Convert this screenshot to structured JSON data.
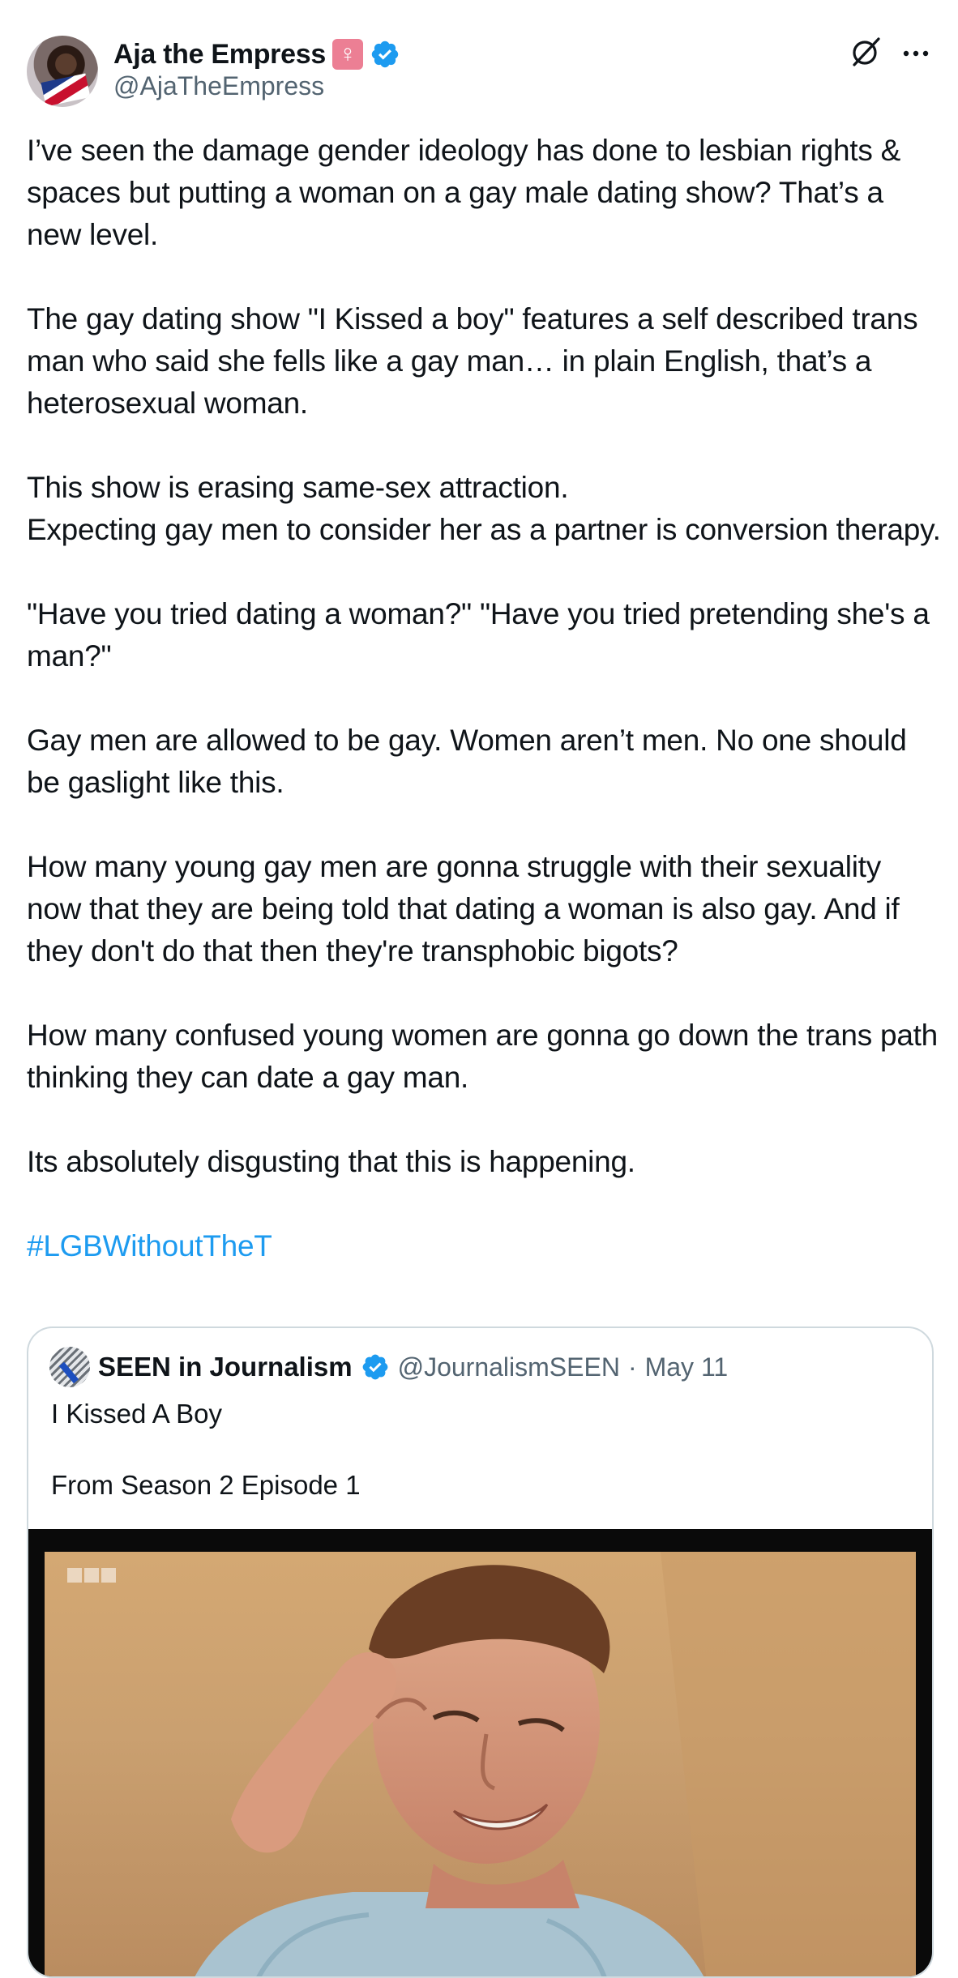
{
  "author": {
    "display_name": "Aja the Empress",
    "emoji": "♀",
    "handle": "@AjaTheEmpress",
    "verified": true
  },
  "icons": {
    "grok": "grok-icon",
    "more": "more-icon",
    "verified": "verified-badge-icon"
  },
  "tweet": {
    "paragraphs": [
      "I’ve seen the damage gender ideology has done to lesbian rights & spaces but putting a woman on a gay male dating show? That’s a new level.",
      "The gay dating show \"I Kissed a boy\" features a self described trans man who said she fells like a gay man… in plain English, that’s a heterosexual woman.",
      "This show is erasing same-sex attraction.\nExpecting gay men to consider her as a partner is conversion therapy.",
      "\"Have you tried dating a woman?\" \"Have you tried pretending she's a man?\"",
      "Gay men are allowed to be gay. Women aren’t men. No one should be gaslight like this.",
      "How many young gay men are gonna struggle with their sexuality now that they are being told that dating a woman is also gay. And if they don't do that then they're transphobic bigots?",
      "How many confused young women are gonna go down the trans path thinking they can date a gay man.",
      "Its absolutely disgusting that this is happening."
    ],
    "hashtag": "#LGBWithoutTheT"
  },
  "quote": {
    "display_name": "SEEN in Journalism",
    "verified": true,
    "handle": "@JournalismSEEN",
    "separator": "·",
    "date": "May 11",
    "text_lines": [
      "I Kissed A Boy",
      "From Season 2 Episode 1"
    ]
  },
  "colors": {
    "text": "#0f1419",
    "secondary": "#536471",
    "link": "#1d9bf0",
    "verified": "#1d9bf0",
    "border": "#cfd9de"
  }
}
